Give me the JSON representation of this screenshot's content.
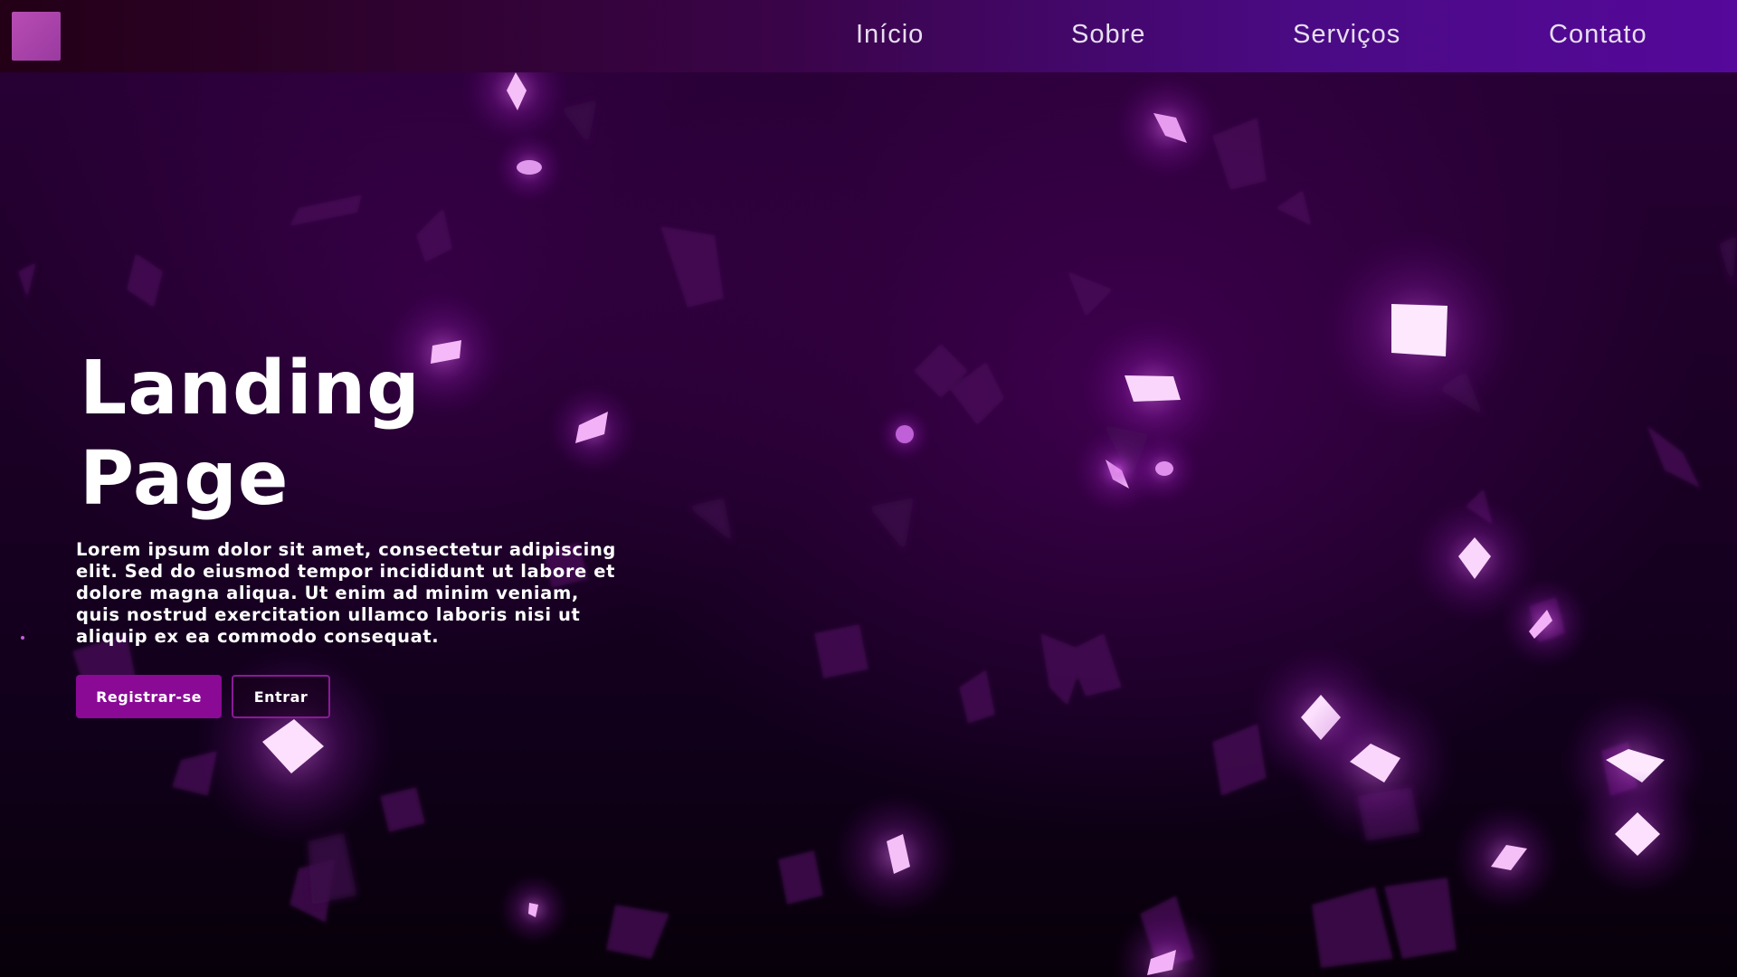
{
  "nav": {
    "logo": "logo",
    "links": [
      "Início",
      "Sobre",
      "Serviços",
      "Contato"
    ]
  },
  "hero": {
    "title": "Landing Page",
    "text": "Lorem ipsum dolor sit amet, consectetur adipiscing elit. Sed do eiusmod tempor incididunt ut labore et dolore magna aliqua. Ut enim ad minim veniam, quis nostrud exercitation ullamco laboris nisi ut aliquip ex ea commodo consequat.",
    "primary_button": "Registrar-se",
    "secondary_button": "Entrar"
  },
  "colors": {
    "accent": "#8a0a96",
    "confetti_glow": "#f3a6f7",
    "confetti_dim": "#5a1a66"
  }
}
